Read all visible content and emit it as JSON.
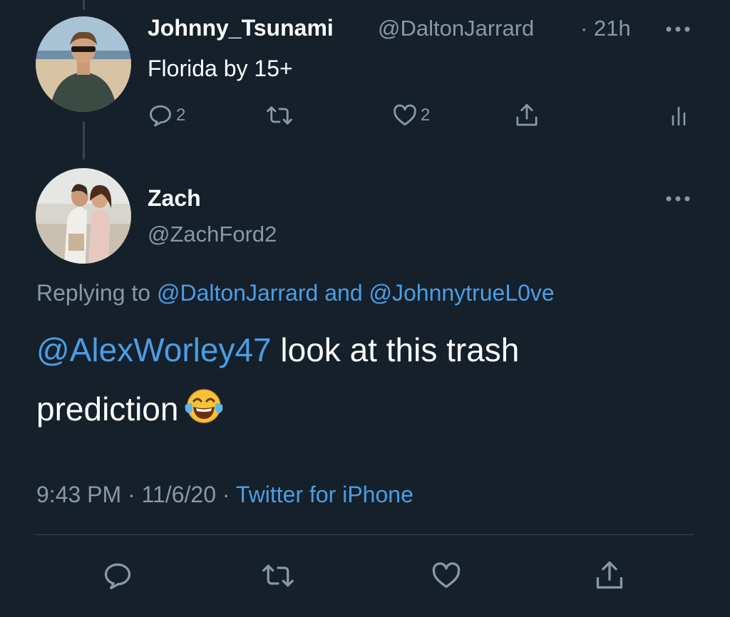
{
  "parent_tweet": {
    "display_name": "Johnny_Tsunami",
    "handle": "@DaltonJarrard",
    "separator": "·",
    "time_ago": "21h",
    "text": "Florida by 15+",
    "reply_count": "2",
    "like_count": "2"
  },
  "main_tweet": {
    "display_name": "Zach",
    "handle": "@ZachFord2",
    "replying_prefix": "Replying to",
    "replying_user1": "@DaltonJarrard",
    "replying_and": "and",
    "replying_user2": "@JohnnytrueL0ve",
    "mention": "@AlexWorley47",
    "text_line1": "look at this trash",
    "text_line2": "prediction",
    "emoji": "face-with-tears-of-joy",
    "time": "9:43 PM",
    "sep1": "·",
    "date": "11/6/20",
    "sep2": "·",
    "source": "Twitter for iPhone"
  },
  "icons": {
    "reply": "reply-icon",
    "retweet": "retweet-icon",
    "like": "heart-icon",
    "share": "share-icon",
    "analytics": "analytics-icon",
    "more": "more-icon"
  },
  "colors": {
    "background": "#15202b",
    "link": "#4a9ee5",
    "secondary": "#8899a6",
    "divider": "#38444d"
  }
}
